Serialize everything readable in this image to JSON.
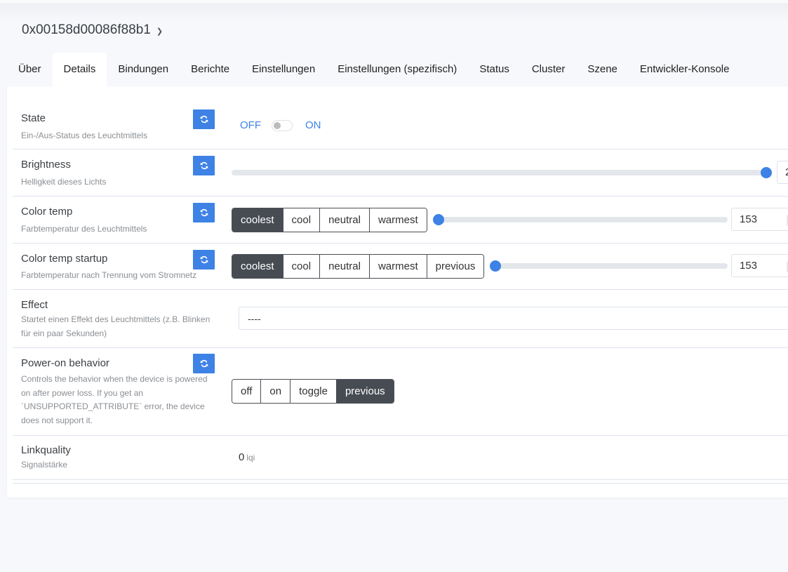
{
  "device": {
    "title": "0x00158d00086f88b1",
    "dropdown_icon": "chevron-down-icon"
  },
  "tabs": [
    {
      "label": "Über"
    },
    {
      "label": "Details",
      "active": true
    },
    {
      "label": "Bindungen"
    },
    {
      "label": "Berichte"
    },
    {
      "label": "Einstellungen"
    },
    {
      "label": "Einstellungen (spezifisch)"
    },
    {
      "label": "Status"
    },
    {
      "label": "Cluster"
    },
    {
      "label": "Szene"
    },
    {
      "label": "Entwickler-Konsole"
    }
  ],
  "accent_color": "#3e82e5",
  "selected_button_color": "#474c53",
  "features": {
    "state": {
      "label": "State",
      "description": "Ein-/Aus-Status des Leuchtmittels",
      "off_label": "OFF",
      "on_label": "ON",
      "value": "OFF",
      "refresh_icon": "refresh-icon"
    },
    "brightness": {
      "label": "Brightness",
      "description": "Helligkeit dieses Lichts",
      "value_partial": "2",
      "slider_fraction": 1.0
    },
    "color_temp": {
      "label": "Color temp",
      "description": "Farbtemperatur des Leuchtmittels",
      "presets": [
        "coolest",
        "cool",
        "neutral",
        "warmest"
      ],
      "selected": "coolest",
      "value": "153",
      "slider_fraction": 0.0
    },
    "color_temp_startup": {
      "label": "Color temp startup",
      "description": "Farbtemperatur nach Trennung vom Stromnetz",
      "presets": [
        "coolest",
        "cool",
        "neutral",
        "warmest",
        "previous"
      ],
      "selected": "coolest",
      "value": "153",
      "slider_fraction": 0.0
    },
    "effect": {
      "label": "Effect",
      "description": "Startet einen Effekt des Leuchtmittels (z.B. Blinken für ein paar Sekunden)",
      "selected": "----"
    },
    "power_on_behavior": {
      "label": "Power-on behavior",
      "description": "Controls the behavior when the device is powered on after power loss. If you get an `UNSUPPORTED_ATTRIBUTE` error, the device does not support it.",
      "options": [
        "off",
        "on",
        "toggle",
        "previous"
      ],
      "selected": "previous"
    },
    "linkquality": {
      "label": "Linkquality",
      "description": "Signalstärke",
      "value": "0",
      "unit": "lqi"
    }
  }
}
